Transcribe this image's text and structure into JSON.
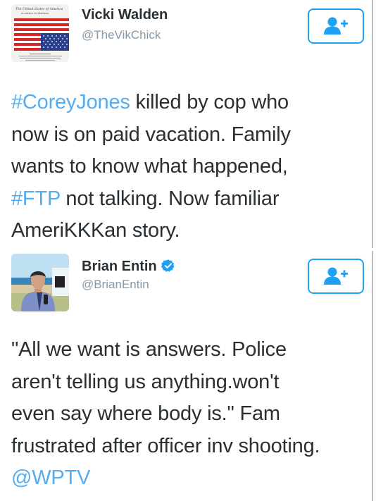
{
  "tweets": [
    {
      "display_name": "Vicki Walden",
      "username": "@TheVikChick",
      "avatar": "upside-down-flag-avatar",
      "follow_button": "follow-user-icon",
      "text": {
        "line1_link": "#CoreyJones",
        "line1_rest": " killed by cop who",
        "line2": "now is on paid vacation. Family",
        "line3": "wants to know what happened,",
        "line4_link": "#FTP",
        "line4_rest": " not talking. Now familiar",
        "line5": "AmeriKKKan story."
      }
    },
    {
      "display_name": "Brian Entin",
      "username": "@BrianEntin",
      "verified": true,
      "avatar": "reporter-photo-avatar",
      "follow_button": "follow-user-icon",
      "text": {
        "line1": "\"All we want is answers. Police",
        "line2": "aren't telling us anything.won't",
        "line3": "even say where body is.\" Fam",
        "line4": "frustrated after officer inv shooting.",
        "line5_link": "@WPTV"
      }
    }
  ],
  "colors": {
    "link": "#55acee",
    "follow_border": "#1da1f2",
    "name": "#292f33",
    "username": "#8899a6",
    "verified": "#1da1f2"
  }
}
